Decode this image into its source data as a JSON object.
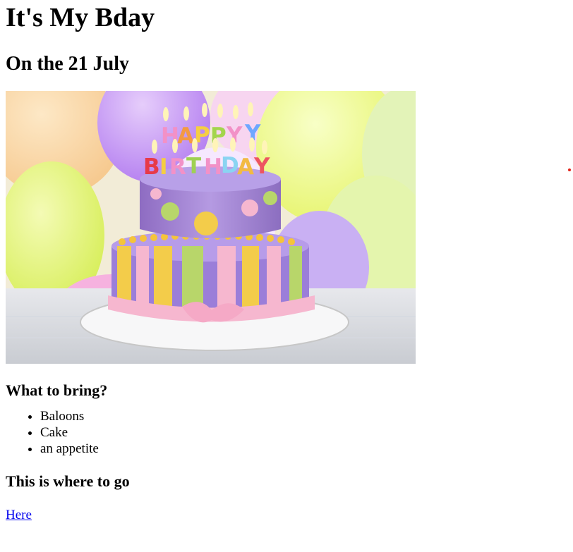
{
  "page": {
    "title": "It's My Bday",
    "subtitle": "On the 21 July",
    "cake_text": "HAPPY BIRTHDAY",
    "bring_heading": "What to bring?",
    "bring_items": [
      "Baloons",
      "Cake",
      "an appetite"
    ],
    "go_heading": "This is where to go",
    "link_text": "Here"
  },
  "colors": {
    "link": "#0000ee",
    "marker_dot": "#e2231a",
    "cake_purple": "#a585d3",
    "ribbon_pink": "#f6b7cf",
    "stripe_yellow": "#f3cc4a",
    "stripe_green": "#b8d66a"
  }
}
